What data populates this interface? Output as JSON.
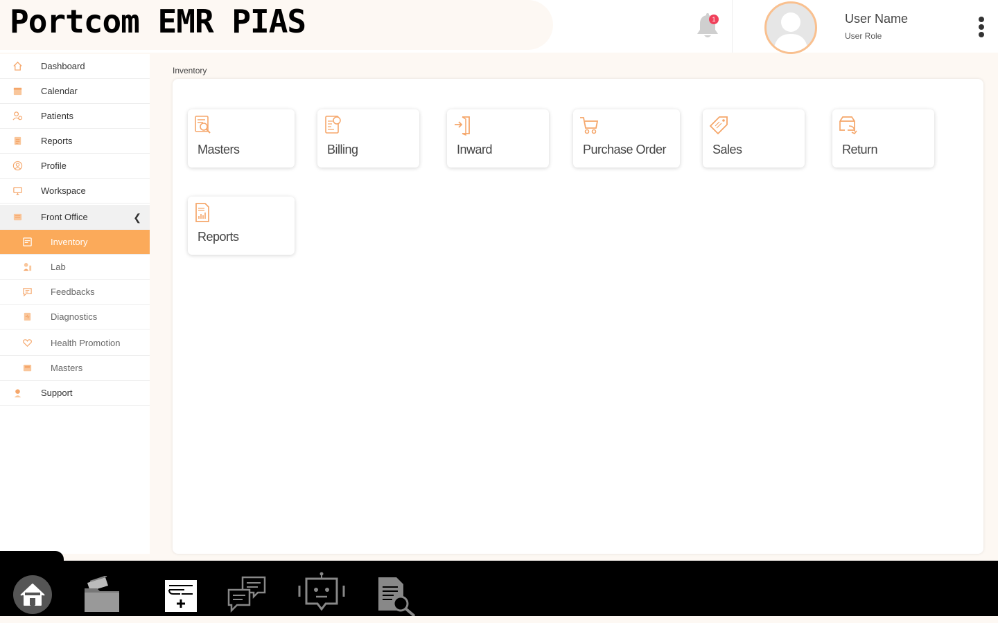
{
  "header": {
    "app_title": "Portcom EMR PIAS",
    "notification_count": "1",
    "user_name": "User Name",
    "user_role": "User Role"
  },
  "sidebar": {
    "items": [
      {
        "label": "Dashboard",
        "icon": "home-icon"
      },
      {
        "label": "Calendar",
        "icon": "calendar-icon"
      },
      {
        "label": "Patients",
        "icon": "patients-icon"
      },
      {
        "label": "Reports",
        "icon": "reports-icon"
      },
      {
        "label": "Profile",
        "icon": "profile-icon"
      },
      {
        "label": "Workspace",
        "icon": "workspace-icon"
      },
      {
        "label": "Front Office",
        "icon": "front-office-icon",
        "expanded": true
      },
      {
        "label": "Inventory",
        "icon": "inventory-icon",
        "active": true
      },
      {
        "label": "Lab",
        "icon": "lab-icon"
      },
      {
        "label": "Feedbacks",
        "icon": "feedback-icon"
      },
      {
        "label": "Diagnostics",
        "icon": "diagnostics-icon"
      },
      {
        "label": "Health Promotion",
        "icon": "health-promotion-icon"
      },
      {
        "label": "Masters",
        "icon": "masters-icon"
      },
      {
        "label": "Support",
        "icon": "support-icon"
      }
    ]
  },
  "main": {
    "breadcrumb": "Inventory",
    "cards": [
      {
        "label": "Masters",
        "icon": "masters-search-icon"
      },
      {
        "label": "Billing",
        "icon": "billing-icon"
      },
      {
        "label": "Inward",
        "icon": "inward-icon"
      },
      {
        "label": "Purchase Order",
        "icon": "cart-icon"
      },
      {
        "label": "Sales",
        "icon": "sale-tag-icon"
      },
      {
        "label": "Return",
        "icon": "return-icon"
      },
      {
        "label": "Reports",
        "icon": "report-document-icon"
      }
    ]
  },
  "dock": {
    "items": [
      "home-icon",
      "folder-icon",
      "medical-record-icon",
      "chat-icon",
      "chatbot-icon",
      "document-search-icon"
    ]
  },
  "colors": {
    "accent": "#fbaa5a",
    "icon_orange": "#f5a66a",
    "badge": "#f0405a",
    "dock": "#000000"
  }
}
